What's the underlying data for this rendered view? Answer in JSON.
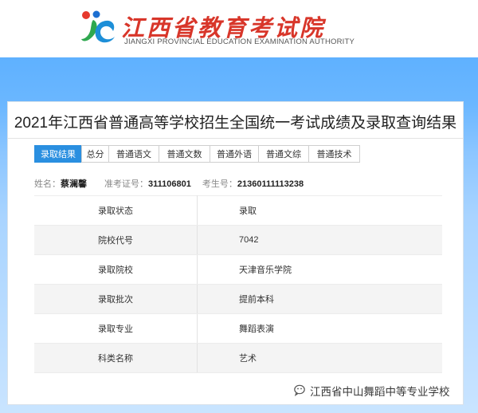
{
  "header": {
    "title": "江西省教育考试院",
    "subtitle": "JIANGXI PROVINCIAL EDUCATION EXAMINATION AUTHORITY",
    "logo_icon": "jx-logo-icon"
  },
  "card": {
    "title": "2021年江西省普通高等学校招生全国统一考试成绩及录取查询结果"
  },
  "tabs": [
    {
      "label": "录取结果",
      "active": true
    },
    {
      "label": "总分"
    },
    {
      "label": "普通语文"
    },
    {
      "label": "普通文数"
    },
    {
      "label": "普通外语"
    },
    {
      "label": "普通文综"
    },
    {
      "label": "普通技术"
    }
  ],
  "student": {
    "name_label": "姓名：",
    "name": "蔡澜馨",
    "exam_no_label": "准考证号：",
    "exam_no": "311106801",
    "candidate_no_label": "考生号：",
    "candidate_no": "21360111113238"
  },
  "results": [
    {
      "key": "录取状态",
      "value": "录取"
    },
    {
      "key": "院校代号",
      "value": "7042"
    },
    {
      "key": "录取院校",
      "value": "天津音乐学院"
    },
    {
      "key": "录取批次",
      "value": "提前本科"
    },
    {
      "key": "录取专业",
      "value": "舞蹈表演"
    },
    {
      "key": "科类名称",
      "value": "艺术"
    }
  ],
  "watermark": {
    "text": "江西省中山舞蹈中等专业学校",
    "icon": "wechat-icon"
  },
  "colors": {
    "brand_red": "#d8362a",
    "tab_active": "#2a8fe0",
    "band_blue": "#6bb7ff"
  }
}
